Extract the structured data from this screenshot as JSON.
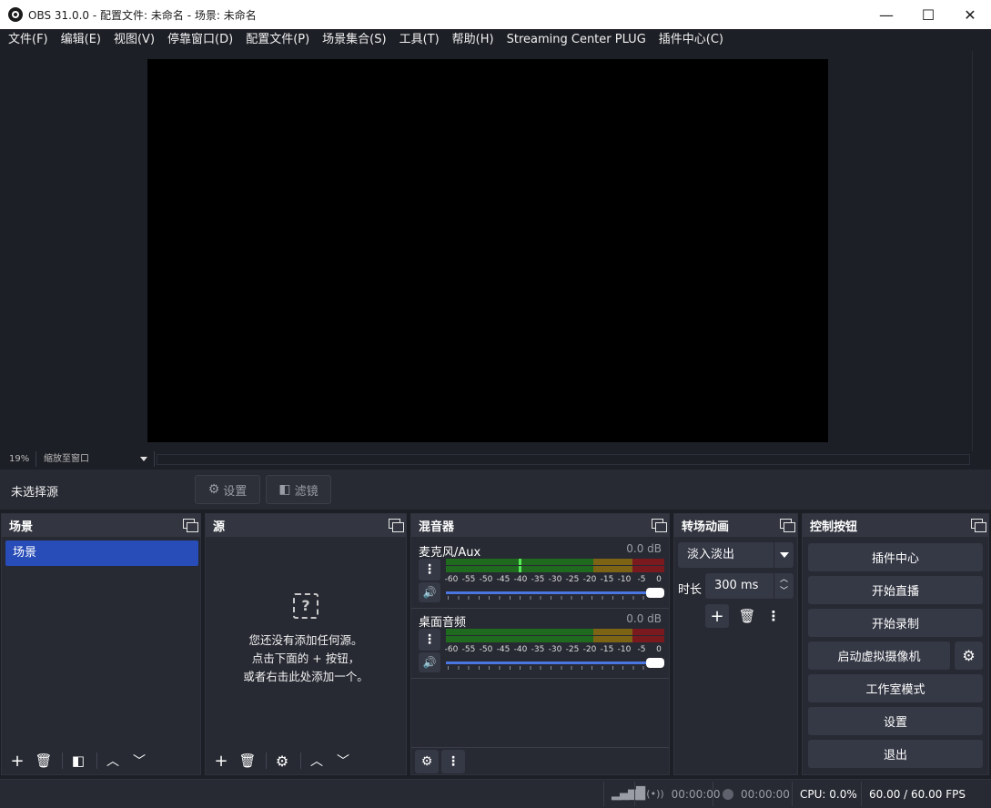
{
  "window": {
    "title": "OBS 31.0.0 - 配置文件: 未命名 - 场景: 未命名",
    "minimize": "—",
    "maximize": "☐",
    "close": "✕"
  },
  "menu": [
    "文件(F)",
    "编辑(E)",
    "视图(V)",
    "停靠窗口(D)",
    "配置文件(P)",
    "场景集合(S)",
    "工具(T)",
    "帮助(H)",
    "Streaming Center PLUG",
    "插件中心(C)"
  ],
  "preview": {
    "zoom": "19%",
    "zoom_mode": "缩放至窗口"
  },
  "context": {
    "no_source": "未选择源",
    "settings": "设置",
    "filters": "滤镜"
  },
  "scenes": {
    "title": "场景",
    "items": [
      "场景"
    ]
  },
  "sources": {
    "title": "源",
    "empty_line1": "您还没有添加任何源。",
    "empty_line2": "点击下面的 + 按钮，",
    "empty_line3": "或者右击此处添加一个。"
  },
  "mixer": {
    "title": "混音器",
    "ticks": [
      "-60",
      "-55",
      "-50",
      "-45",
      "-40",
      "-35",
      "-30",
      "-25",
      "-20",
      "-15",
      "-10",
      "-5",
      "0"
    ],
    "channels": [
      {
        "name": "麦克风/Aux",
        "db": "0.0 dB",
        "peak_db": -40,
        "volume": 1.0
      },
      {
        "name": "桌面音频",
        "db": "0.0 dB",
        "peak_db": null,
        "volume": 1.0
      }
    ]
  },
  "transitions": {
    "title": "转场动画",
    "selected": "淡入淡出",
    "duration_label": "时长",
    "duration": "300 ms"
  },
  "controls": {
    "title": "控制按钮",
    "plugin_center": "插件中心",
    "start_stream": "开始直播",
    "start_record": "开始录制",
    "virtual_cam": "启动虚拟摄像机",
    "studio_mode": "工作室模式",
    "settings": "设置",
    "exit": "退出"
  },
  "status": {
    "stream_time": "00:00:00",
    "record_time": "00:00:00",
    "cpu": "CPU: 0.0%",
    "fps": "60.00 / 60.00 FPS"
  },
  "colors": {
    "accent": "#284cb8",
    "background": "#1d1f26",
    "panel": "#272a33"
  }
}
